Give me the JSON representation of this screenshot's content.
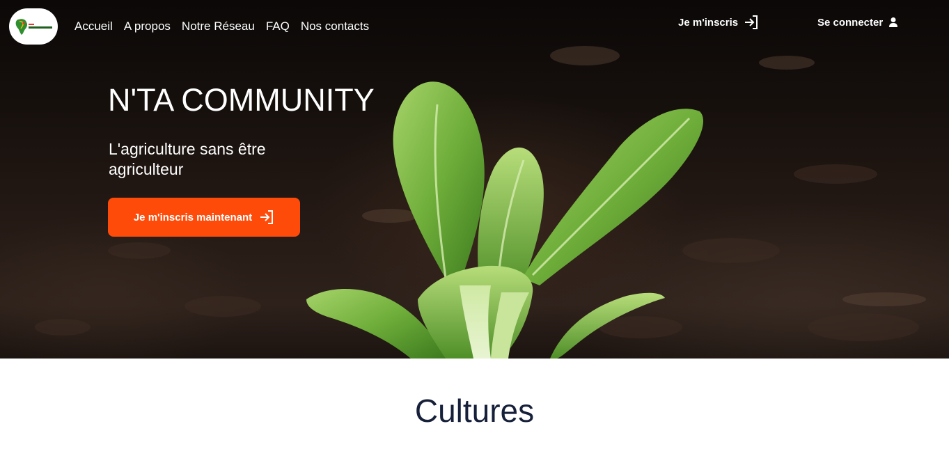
{
  "navbar": {
    "logo_alt": "N'TA COMMUNITY",
    "links": [
      "Accueil",
      "A propos",
      "Notre Réseau",
      "FAQ",
      "Nos contacts"
    ],
    "signup_label": "Je m'inscris",
    "login_label": "Se connecter"
  },
  "hero": {
    "title": "N'TA COMMUNITY",
    "subtitle": "L'agriculture sans être agriculteur",
    "cta_label": "Je m'inscris maintenant"
  },
  "section": {
    "title": "Cultures"
  },
  "icons": {
    "signup": "sign-in-arrow-icon",
    "login": "user-icon",
    "cta": "sign-in-arrow-icon"
  },
  "colors": {
    "accent": "#ff4b0a",
    "text_dark": "#17203a",
    "nav_text": "#ffffff"
  }
}
